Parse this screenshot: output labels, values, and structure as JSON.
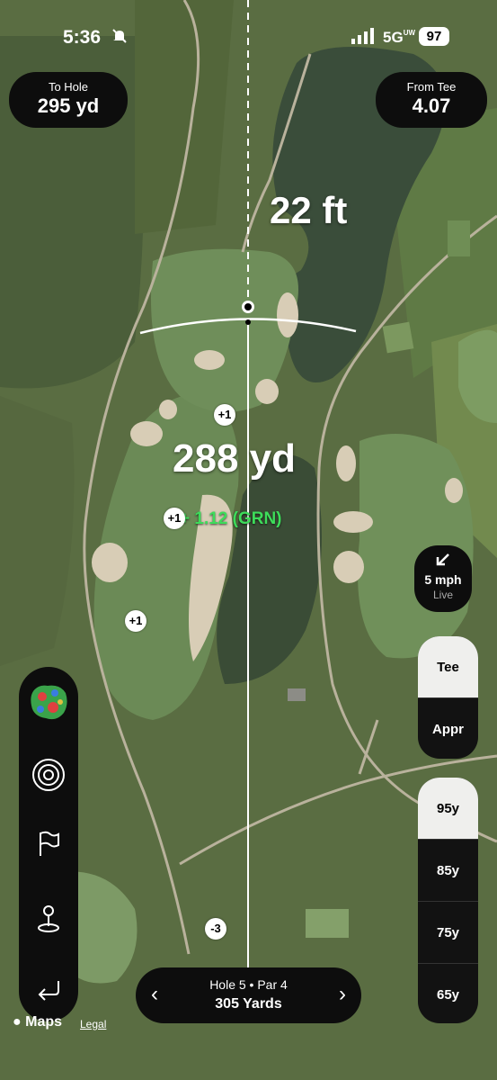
{
  "status_bar": {
    "time": "5:36",
    "network": "5G",
    "network_sub": "UW",
    "battery": "97"
  },
  "to_hole": {
    "label": "To Hole",
    "value": "295 yd"
  },
  "from_tee": {
    "label": "From Tee",
    "value": "4.07"
  },
  "map": {
    "distance_ft": "22 ft",
    "distance_yd": "288 yd",
    "elevation": "+ 1.12 (GRN)",
    "markers": [
      "+1",
      "+1",
      "+1",
      "-3"
    ]
  },
  "wind": {
    "speed": "5 mph",
    "status": "Live"
  },
  "shot_mode": {
    "options": [
      "Tee",
      "Appr"
    ],
    "selected": "Tee"
  },
  "yardages": {
    "options": [
      "95y",
      "85y",
      "75y",
      "65y"
    ],
    "selected": "95y"
  },
  "hole_nav": {
    "hole": "Hole 5 • Par 4",
    "yards": "305 Yards"
  },
  "attribution": {
    "brand": "Maps",
    "legal": "Legal"
  },
  "colors": {
    "accent_green": "#3ddc5a",
    "pill_bg": "#0d0d0d",
    "selected_bg": "#efefed"
  }
}
